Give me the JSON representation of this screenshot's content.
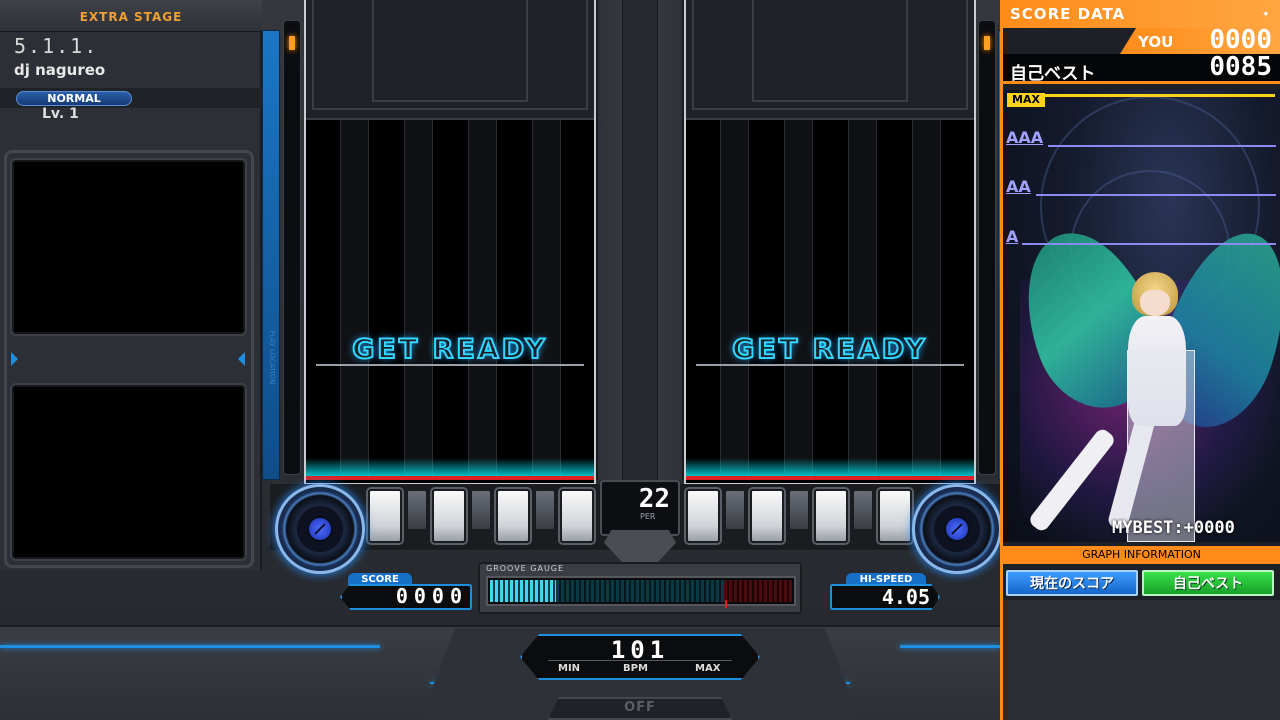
{
  "stage": {
    "label": "EXTRA STAGE",
    "title": "5.1.1.",
    "artist": "dj nagureo",
    "difficulty": "NORMAL",
    "level": "Lv. 1"
  },
  "lanes": {
    "left_message": "GET READY",
    "right_message": "GET READY"
  },
  "play": {
    "percent": "22",
    "percent_unit": "PER",
    "score_label": "SCORE",
    "score_value": "0000",
    "gauge_label": "GROOVE GAUGE",
    "gauge_percent": 22,
    "hispeed_label": "HI-SPEED",
    "hispeed_value": "4.05",
    "bpm_value": "101",
    "bpm_min": "MIN",
    "bpm_label": "BPM",
    "bpm_max": "MAX",
    "option_state": "OFF",
    "side_label": "PLAY LOCATION"
  },
  "score_data": {
    "title": "SCORE DATA",
    "you_label": "YOU",
    "you_value": "0000",
    "best_label": "自己ベスト",
    "best_value": "0085",
    "grades": [
      "MAX",
      "AAA",
      "AA",
      "A"
    ],
    "mybest_text": "MYBEST:+0000",
    "graph_info": "GRAPH INFORMATION",
    "btn_current": "現在のスコア",
    "btn_mybest": "自己ベスト"
  },
  "colors": {
    "accent_blue": "#1e8fe0",
    "accent_orange": "#ff8c1a",
    "ready_cyan": "#33d6ff",
    "judge_red": "#e02020",
    "max_yellow": "#ffd21a"
  }
}
